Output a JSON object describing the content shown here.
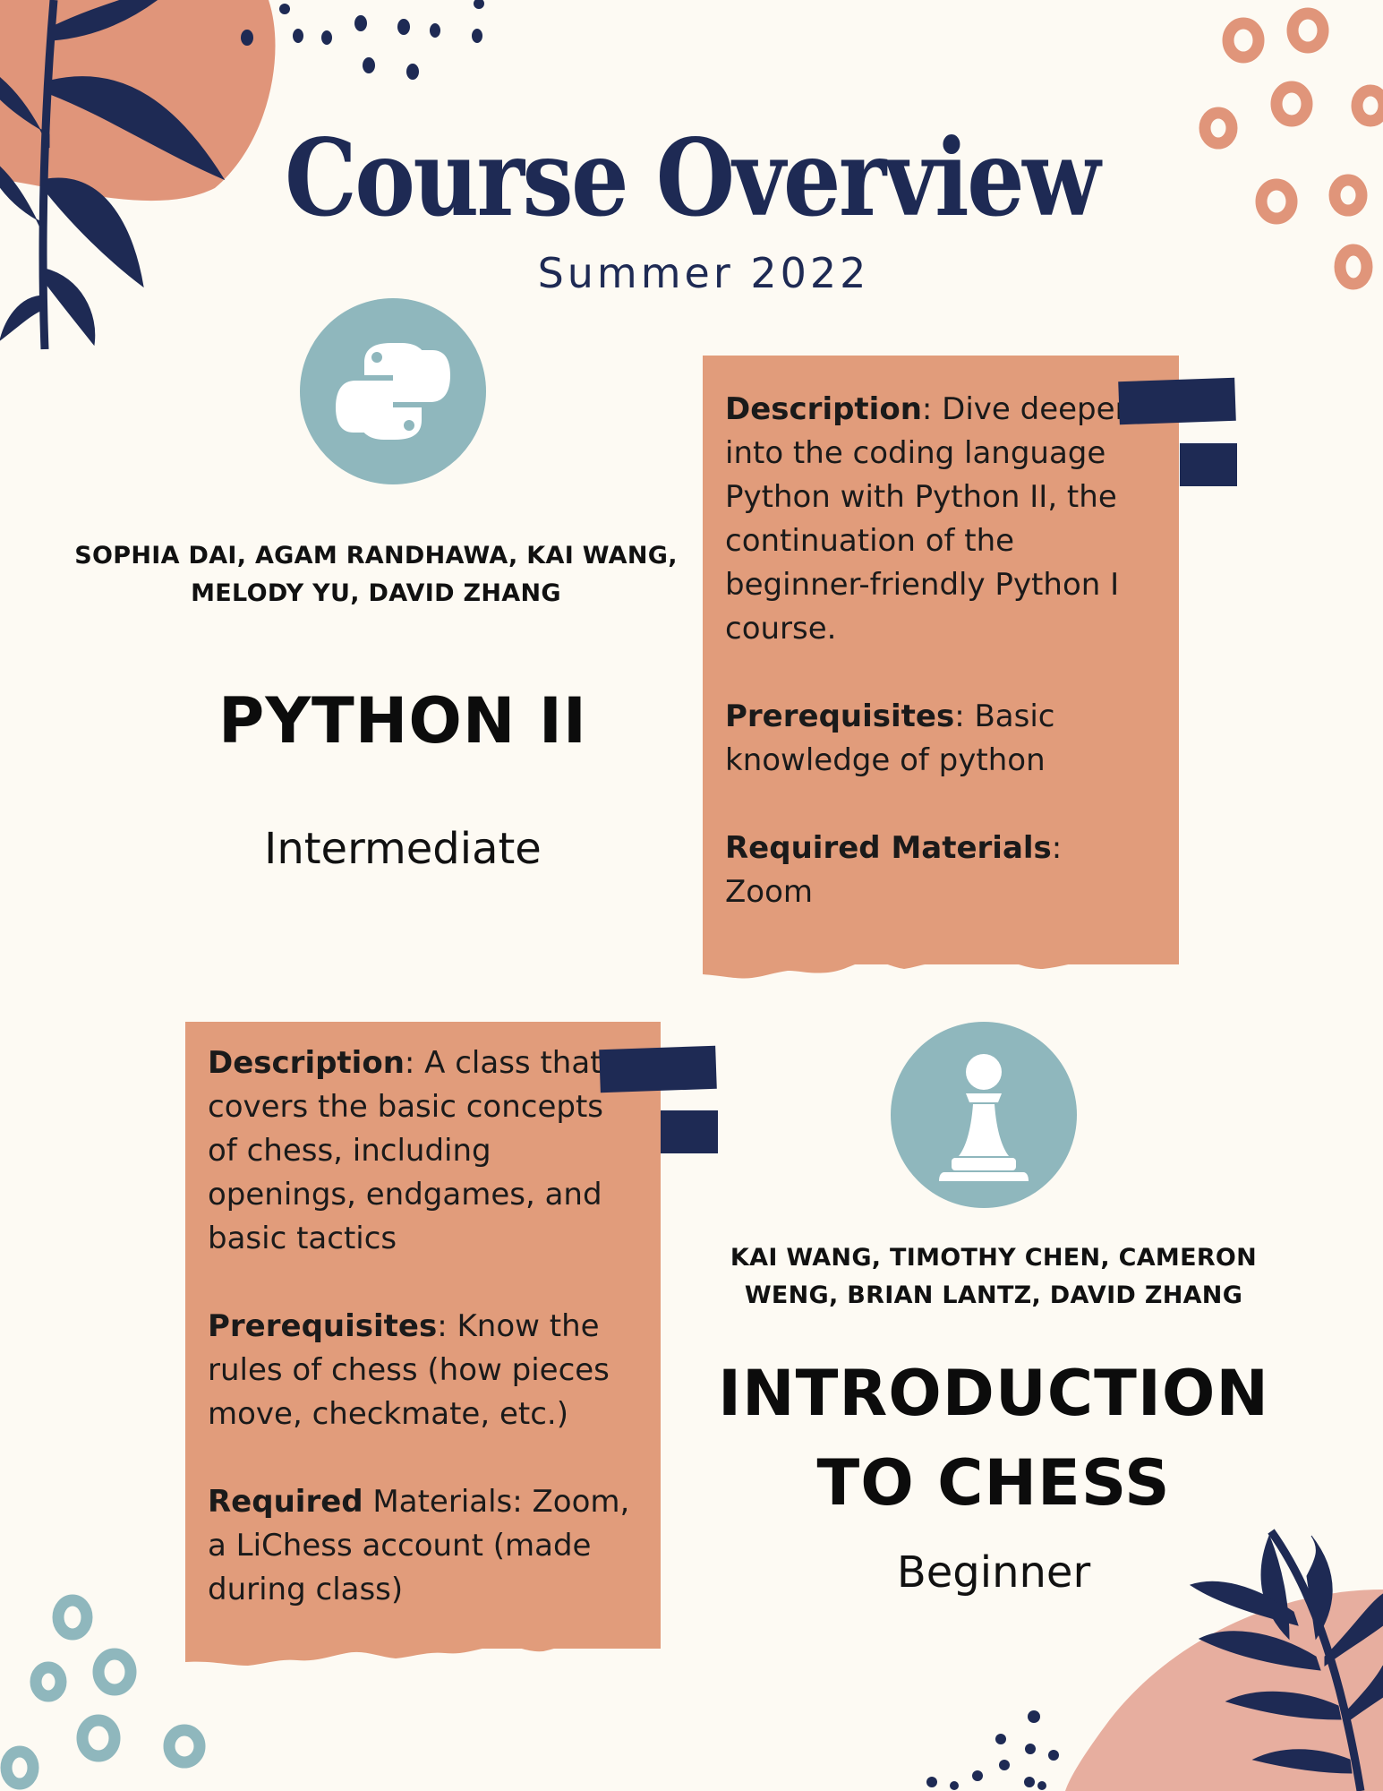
{
  "header": {
    "title": "Course Overview",
    "subtitle": "Summer 2022"
  },
  "courses": [
    {
      "icon": "python-logo-icon",
      "authors_line1": "SOPHIA DAI, AGAM RANDHAWA, KAI WANG,",
      "authors_line2": "MELODY YU, DAVID ZHANG",
      "name": "PYTHON II",
      "level": "Intermediate",
      "description_label": "Description",
      "description": ": Dive deeper into the coding language Python with Python II, the continuation of the beginner-friendly Python I course.",
      "prerequisites_label": "Prerequisites",
      "prerequisites": ": Basic knowledge of python",
      "materials_label": "Required Materials",
      "materials": ": Zoom"
    },
    {
      "icon": "chess-pawn-icon",
      "authors_line1": "KAI WANG, TIMOTHY CHEN, CAMERON",
      "authors_line2": "WENG, BRIAN LANTZ, DAVID ZHANG",
      "name_line1": "INTRODUCTION",
      "name_line2": "TO CHESS",
      "level": "Beginner",
      "description_label": "Description",
      "description": ": A class that covers the basic concepts of chess, including openings, endgames, and basic tactics",
      "prerequisites_label": "Prerequisites",
      "prerequisites": ": Know the rules of chess (how pieces move, checkmate, etc.)",
      "materials_label": "Required",
      "materials": " Materials: Zoom, a LiChess account (made during class)"
    }
  ],
  "colors": {
    "navy": "#1e2a54",
    "salmon": "#e19c7b",
    "teal": "#8fb7bd",
    "background": "#fdfaf3"
  }
}
